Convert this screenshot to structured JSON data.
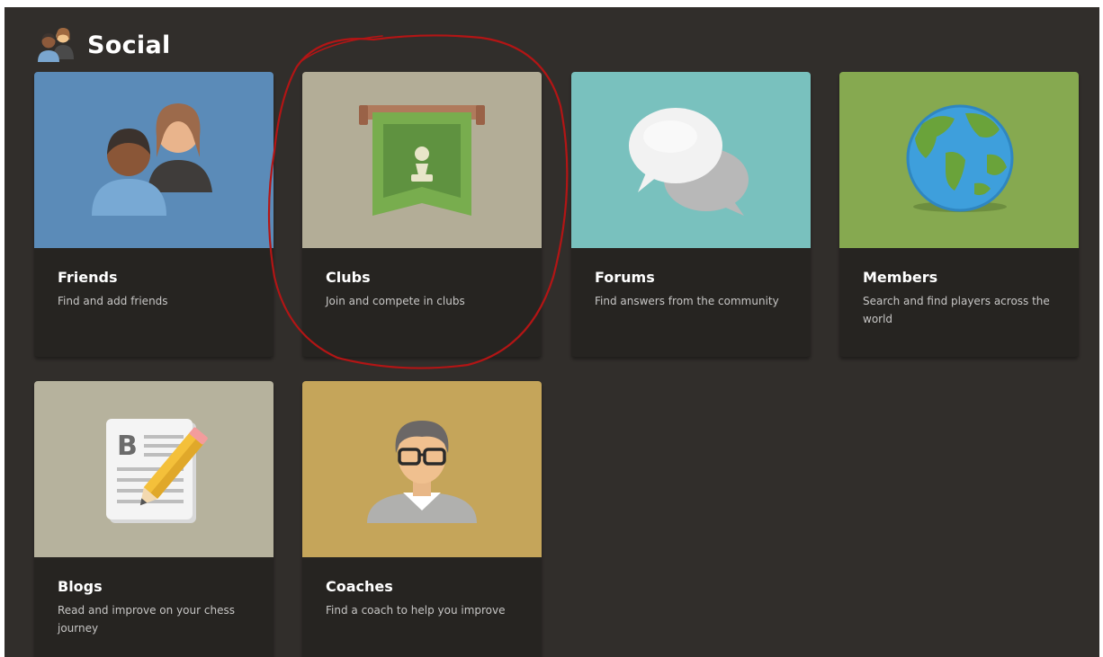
{
  "header": {
    "title": "Social",
    "icon": "people-icon"
  },
  "cards": {
    "friends": {
      "title": "Friends",
      "description": "Find and add friends",
      "icon": "friends-icon",
      "color": "#5b8bb8"
    },
    "clubs": {
      "title": "Clubs",
      "description": "Join and compete in clubs",
      "icon": "club-banner-icon",
      "color": "#b3ad97"
    },
    "forums": {
      "title": "Forums",
      "description": "Find answers from the community",
      "icon": "speech-bubbles-icon",
      "color": "#79c1be"
    },
    "members": {
      "title": "Members",
      "description": "Search and find players across the world",
      "icon": "globe-icon",
      "color": "#86a950"
    },
    "blogs": {
      "title": "Blogs",
      "description": "Read and improve on your chess journey",
      "icon": "blog-pencil-icon",
      "color": "#b6b29d"
    },
    "coaches": {
      "title": "Coaches",
      "description": "Find a coach to help you improve",
      "icon": "coach-icon",
      "color": "#c5a55a"
    }
  },
  "colors": {
    "background": "#312e2b",
    "card_body": "#262421",
    "annotation": "#b31515"
  }
}
